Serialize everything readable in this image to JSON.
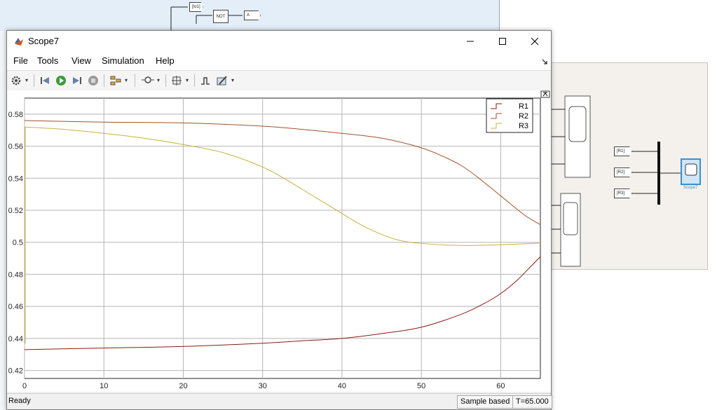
{
  "background": {
    "top_blocks": {
      "tag_in": "[to1]",
      "not_block": "NOT",
      "tag_out": "A"
    },
    "right_tags": [
      "[R1]",
      "[R2]",
      "[R3]"
    ],
    "right_scope_label": "Scope7"
  },
  "window": {
    "title": "Scope7",
    "menu": [
      "File",
      "Tools",
      "View",
      "Simulation",
      "Help"
    ]
  },
  "toolbar_icons": [
    "gear-icon",
    "step-back-icon",
    "run-icon",
    "step-forward-icon",
    "stop-icon",
    "highlight-icon",
    "zoom-icon",
    "autoscale-icon",
    "triggers-icon",
    "style-icon"
  ],
  "status": {
    "ready": "Ready",
    "sample_mode": "Sample based",
    "time": "T=65.000"
  },
  "colors": {
    "R1": "#8b1a12",
    "R2": "#a0522d",
    "R3": "#c9b03a"
  },
  "chart_data": {
    "type": "line",
    "xlim": [
      0,
      65
    ],
    "ylim": [
      0.415,
      0.59
    ],
    "xticks": [
      0,
      10,
      20,
      30,
      40,
      50,
      60
    ],
    "yticks": [
      0.42,
      0.44,
      0.46,
      0.48,
      0.5,
      0.52,
      0.54,
      0.56,
      0.58
    ],
    "grid": true,
    "legend_position": "top-right",
    "series": [
      {
        "name": "R1",
        "x": [
          0,
          10,
          20,
          30,
          35,
          40,
          45,
          50,
          55,
          58,
          60,
          62,
          64,
          65
        ],
        "y": [
          0.433,
          0.434,
          0.435,
          0.437,
          0.4385,
          0.44,
          0.443,
          0.447,
          0.455,
          0.462,
          0.468,
          0.476,
          0.486,
          0.491
        ]
      },
      {
        "name": "R2",
        "x": [
          0,
          10,
          20,
          30,
          35,
          40,
          45,
          50,
          53,
          55,
          57,
          60,
          63,
          65
        ],
        "y": [
          0.576,
          0.575,
          0.5745,
          0.5725,
          0.5705,
          0.568,
          0.565,
          0.559,
          0.553,
          0.548,
          0.541,
          0.529,
          0.517,
          0.511
        ]
      },
      {
        "name": "R3",
        "x": [
          0,
          5,
          10,
          15,
          20,
          25,
          30,
          33,
          36,
          38,
          40,
          42,
          44,
          47,
          50,
          55,
          60,
          65
        ],
        "y": [
          0.572,
          0.5705,
          0.568,
          0.565,
          0.561,
          0.556,
          0.547,
          0.539,
          0.53,
          0.524,
          0.518,
          0.512,
          0.507,
          0.5015,
          0.4993,
          0.498,
          0.4985,
          0.4995
        ]
      }
    ]
  }
}
